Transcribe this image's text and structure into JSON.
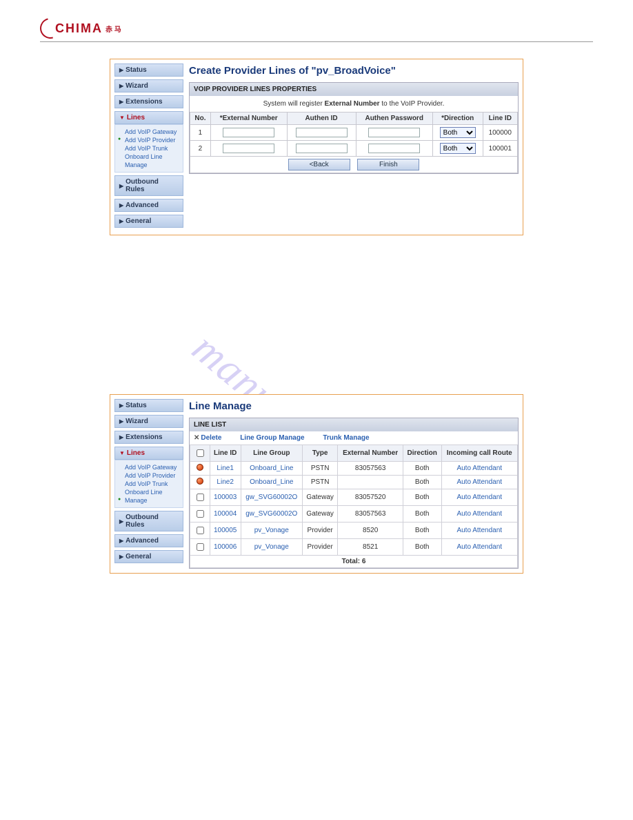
{
  "logo": {
    "text": "CHIMA",
    "sub": "赤 马"
  },
  "watermark": "manualshive.com",
  "panel1": {
    "title": "Create Provider Lines of \"pv_BroadVoice\"",
    "section_head": "VOIP PROVIDER LINES PROPERTIES",
    "section_sub_pre": "System will register ",
    "section_sub_bold": "External Number",
    "section_sub_post": " to the VoIP Provider.",
    "cols": {
      "no": "No.",
      "ext_num": "*External Number",
      "authen_id": "Authen ID",
      "authen_pw": "Authen Password",
      "direction": "*Direction",
      "line_id": "Line ID"
    },
    "rows": [
      {
        "no": "1",
        "direction": "Both",
        "line_id": "100000"
      },
      {
        "no": "2",
        "direction": "Both",
        "line_id": "100001"
      }
    ],
    "btn_back": "<Back",
    "btn_finish": "Finish",
    "sidebar": {
      "items": [
        "Status",
        "Wizard",
        "Extensions"
      ],
      "lines_label": "Lines",
      "subnav": [
        "Add VoIP Gateway",
        "Add VoIP Provider",
        "Add VoIP Trunk",
        "Onboard Line",
        "Manage"
      ],
      "subnav_selected": 1,
      "items_after": [
        "Outbound Rules",
        "Advanced",
        "General"
      ]
    }
  },
  "panel2": {
    "title": "Line Manage",
    "section_head": "LINE LIST",
    "toolbar": {
      "delete": "Delete",
      "lg_manage": "Line Group Manage",
      "trunk_manage": "Trunk Manage"
    },
    "cols": {
      "chk": "",
      "line_id": "Line ID",
      "line_group": "Line Group",
      "type": "Type",
      "ext_num": "External Number",
      "direction": "Direction",
      "route": "Incoming call Route"
    },
    "rows": [
      {
        "status": "ball",
        "line_id": "Line1",
        "line_group": "Onboard_Line",
        "type": "PSTN",
        "ext_num": "83057563",
        "direction": "Both",
        "route": "Auto Attendant"
      },
      {
        "status": "ball",
        "line_id": "Line2",
        "line_group": "Onboard_Line",
        "type": "PSTN",
        "ext_num": "",
        "direction": "Both",
        "route": "Auto Attendant"
      },
      {
        "status": "chk",
        "line_id": "100003",
        "line_group": "gw_SVG60002O",
        "type": "Gateway",
        "ext_num": "83057520",
        "direction": "Both",
        "route": "Auto Attendant"
      },
      {
        "status": "chk",
        "line_id": "100004",
        "line_group": "gw_SVG60002O",
        "type": "Gateway",
        "ext_num": "83057563",
        "direction": "Both",
        "route": "Auto Attendant"
      },
      {
        "status": "chk",
        "line_id": "100005",
        "line_group": "pv_Vonage",
        "type": "Provider",
        "ext_num": "8520",
        "direction": "Both",
        "route": "Auto Attendant"
      },
      {
        "status": "chk",
        "line_id": "100006",
        "line_group": "pv_Vonage",
        "type": "Provider",
        "ext_num": "8521",
        "direction": "Both",
        "route": "Auto Attendant"
      }
    ],
    "total_label": "Total: 6",
    "sidebar": {
      "items": [
        "Status",
        "Wizard",
        "Extensions"
      ],
      "lines_label": "Lines",
      "subnav": [
        "Add VoIP Gateway",
        "Add VoIP Provider",
        "Add VoIP Trunk",
        "Onboard Line",
        "Manage"
      ],
      "subnav_selected": 4,
      "items_after": [
        "Outbound Rules",
        "Advanced",
        "General"
      ]
    }
  }
}
